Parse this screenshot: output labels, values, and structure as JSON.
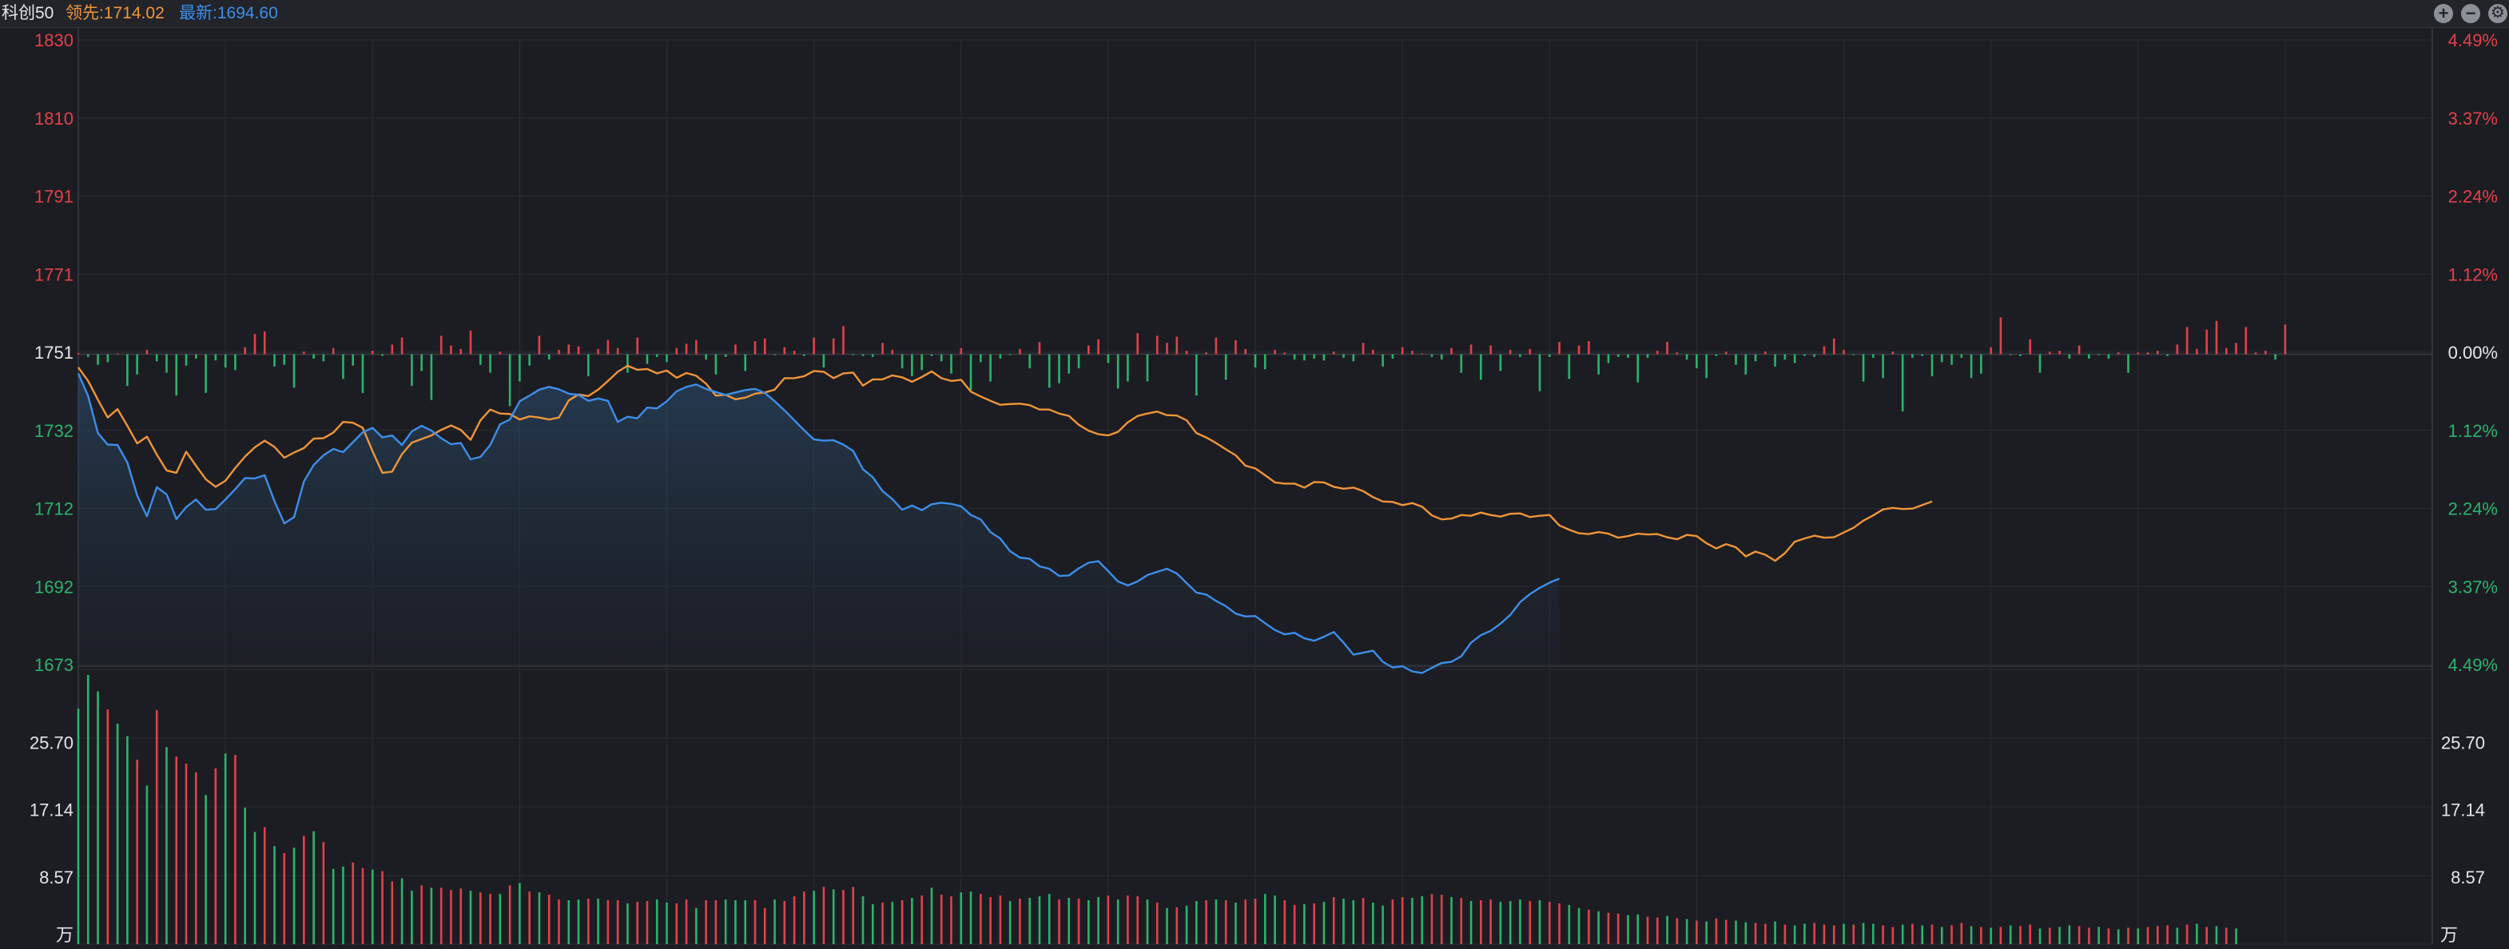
{
  "header": {
    "name": "科创50",
    "leader_label": "领先:1714.02",
    "latest_label": "最新:1694.60"
  },
  "controls": [
    {
      "name": "zoom-in-icon",
      "glyph": "+"
    },
    {
      "name": "zoom-out-icon",
      "glyph": "−"
    },
    {
      "name": "settings-icon",
      "glyph": "⚙"
    }
  ],
  "colors": {
    "background": "#1c1d22",
    "up": "#e2414b",
    "down": "#2bb36e",
    "leader_line": "#f0953a",
    "latest_line": "#3d8eea",
    "grid": "#2a2c33",
    "neutral_text": "#e4e6ea"
  },
  "chart_data": {
    "type": "line",
    "price_panel": {
      "ylim": [
        1673,
        1830
      ],
      "base_price": 1751,
      "left_ticks": [
        "1830",
        "1810",
        "1791",
        "1771",
        "1751",
        "1732",
        "1712",
        "1692",
        "1673"
      ],
      "right_ticks": [
        "4.49%",
        "3.37%",
        "2.24%",
        "1.12%",
        "0.00%",
        "1.12%",
        "2.24%",
        "3.37%",
        "4.49%"
      ],
      "total_minutes": 241,
      "series": [
        {
          "key": "leader",
          "values": [
            1747.7,
            1744.3,
            1739.6,
            1735.1,
            1737.2,
            1733.0,
            1728.6,
            1730.3,
            1725.8,
            1721.8,
            1721.2,
            1726.5,
            1723.0,
            1719.6,
            1717.7,
            1719.2,
            1722.4,
            1725.3,
            1727.6,
            1729.3,
            1727.7,
            1725.0,
            1726.3,
            1727.4,
            1729.8,
            1729.9,
            1731.3,
            1734.0,
            1733.8,
            1732.5,
            1726.6,
            1721.2,
            1721.5,
            1725.9,
            1728.8,
            1729.7,
            1730.6,
            1732.0,
            1733.1,
            1732.0,
            1729.5,
            1734.4,
            1737.1,
            1736.1,
            1736.0,
            1734.6,
            1735.4,
            1735.1,
            1734.6,
            1735.1,
            1739.4,
            1740.9,
            1740.5,
            1742.1,
            1744.3,
            1746.6,
            1748.1,
            1747.1,
            1747.3,
            1746.2,
            1746.9,
            1745.1,
            1746.3,
            1745.6,
            1743.6,
            1740.6,
            1740.8,
            1739.7,
            1740.1,
            1741.1,
            1741.4,
            1742.1,
            1745.0,
            1745.0,
            1745.5,
            1746.8,
            1746.6,
            1745.0,
            1746.2,
            1746.4,
            1743.1,
            1744.7,
            1744.7,
            1745.7,
            1745.2,
            1744.1,
            1745.3,
            1746.7,
            1745.0,
            1744.3,
            1744.6,
            1741.6,
            1740.4,
            1739.3,
            1738.3,
            1738.5,
            1738.6,
            1738.2,
            1737.1,
            1737.1,
            1736.1,
            1735.5,
            1733.3,
            1731.8,
            1730.9,
            1730.6,
            1731.5,
            1733.9,
            1735.5,
            1736.1,
            1736.6,
            1735.7,
            1735.6,
            1734.4,
            1731.2,
            1730.1,
            1728.7,
            1727.1,
            1725.6,
            1723.0,
            1722.3,
            1720.6,
            1718.8,
            1718.5,
            1718.5,
            1717.5,
            1718.9,
            1718.8,
            1717.7,
            1717.2,
            1717.5,
            1716.6,
            1715.1,
            1714.0,
            1713.9,
            1713.1,
            1713.6,
            1712.7,
            1710.5,
            1709.5,
            1709.7,
            1710.6,
            1710.4,
            1711.2,
            1710.6,
            1710.2,
            1710.9,
            1711.0,
            1710.1,
            1710.4,
            1710.6,
            1708.0,
            1706.9,
            1706.0,
            1705.8,
            1706.3,
            1705.9,
            1704.9,
            1705.3,
            1705.9,
            1705.7,
            1705.8,
            1705.0,
            1704.5,
            1705.6,
            1705.3,
            1703.5,
            1702.2,
            1703.3,
            1702.5,
            1700.2,
            1701.4,
            1700.6,
            1699.1,
            1701.0,
            1703.9,
            1704.7,
            1705.4,
            1704.9,
            1705.0,
            1706.2,
            1707.4,
            1709.2,
            1710.5,
            1712.0,
            1712.4,
            1712.1,
            1712.2,
            1713.1,
            1714.0
          ],
          "color": "#f0953a"
        },
        {
          "key": "latest",
          "values": [
            1746.2,
            1740.5,
            1731.2,
            1728.3,
            1728.2,
            1723.8,
            1715.5,
            1710.3,
            1717.6,
            1715.8,
            1709.6,
            1712.6,
            1714.5,
            1711.9,
            1712.1,
            1714.5,
            1717.1,
            1719.9,
            1719.8,
            1720.6,
            1714.1,
            1708.5,
            1710.1,
            1719.0,
            1723.2,
            1725.6,
            1727.2,
            1726.4,
            1728.9,
            1731.4,
            1732.5,
            1730.1,
            1730.6,
            1728.2,
            1731.6,
            1733.0,
            1731.8,
            1729.9,
            1728.4,
            1728.7,
            1724.6,
            1725.2,
            1728.2,
            1733.4,
            1734.6,
            1739.2,
            1740.6,
            1742.1,
            1742.8,
            1742.2,
            1741.1,
            1740.8,
            1739.3,
            1739.9,
            1739.3,
            1734.0,
            1735.3,
            1734.9,
            1737.6,
            1737.4,
            1739.2,
            1741.7,
            1742.8,
            1743.4,
            1742.3,
            1741.5,
            1740.8,
            1741.4,
            1742.0,
            1742.3,
            1741.3,
            1739.2,
            1736.9,
            1734.4,
            1731.9,
            1729.6,
            1729.3,
            1729.4,
            1728.3,
            1726.7,
            1722.1,
            1720.1,
            1716.6,
            1714.6,
            1711.9,
            1713.0,
            1711.8,
            1713.3,
            1713.7,
            1713.4,
            1712.8,
            1710.6,
            1709.5,
            1706.3,
            1704.7,
            1701.5,
            1699.9,
            1699.6,
            1697.7,
            1697.1,
            1695.3,
            1695.4,
            1697.2,
            1698.6,
            1699.0,
            1696.5,
            1693.9,
            1692.9,
            1693.9,
            1695.5,
            1696.3,
            1697.1,
            1695.9,
            1693.5,
            1691.1,
            1690.6,
            1689.0,
            1687.7,
            1685.8,
            1685.1,
            1685.2,
            1683.4,
            1681.7,
            1680.6,
            1681.0,
            1679.6,
            1679.0,
            1680.0,
            1681.2,
            1678.5,
            1675.5,
            1676.0,
            1676.5,
            1673.7,
            1672.3,
            1672.6,
            1671.3,
            1670.9,
            1672.2,
            1673.4,
            1673.7,
            1675.1,
            1678.5,
            1680.4,
            1681.5,
            1683.3,
            1685.5,
            1688.7,
            1690.7,
            1692.3,
            1693.6,
            1694.6
          ],
          "color": "#3d8eea"
        }
      ]
    },
    "strength_bars": {
      "values": [
        0.15,
        -0.3,
        -1.2,
        -0.9,
        0.1,
        -3.6,
        -2.3,
        0.5,
        -0.8,
        -2.1,
        -4.7,
        -1.3,
        -0.5,
        -4.4,
        -0.7,
        -1.5,
        -1.8,
        0.8,
        2.3,
        2.6,
        -1.4,
        -1.2,
        -3.8,
        0.3,
        -0.5,
        -0.8,
        0.7,
        -2.8,
        -1.3,
        -4.4,
        0.4,
        -0.2,
        1.1,
        1.9,
        -3.6,
        -1.9,
        -5.2,
        2.1,
        1.0,
        0.6,
        2.7,
        -1.2,
        -2.1,
        0.3,
        -5.9,
        -3.1,
        -1.3,
        2.1,
        -0.6,
        0.5,
        1.1,
        0.9,
        -2.5,
        0.6,
        1.6,
        0.7,
        -2.1,
        1.9,
        -1.1,
        -0.3,
        -0.9,
        0.7,
        1.2,
        1.6,
        -0.6,
        -2.3,
        -0.3,
        1.1,
        -1.9,
        1.5,
        1.8,
        -0.1,
        0.8,
        0.4,
        -0.2,
        1.9,
        -1.5,
        1.8,
        3.2,
        -0.1,
        -0.2,
        -0.3,
        1.3,
        0.5,
        -1.6,
        -2.5,
        -1.8,
        -0.2,
        -0.8,
        -2.2,
        0.7,
        -4.1,
        -0.9,
        -3.1,
        -0.5,
        -0.1,
        0.6,
        -1.6,
        1.4,
        -3.8,
        -3.3,
        -2.2,
        -1.6,
        1.0,
        1.7,
        -1.0,
        -3.9,
        -3.1,
        2.4,
        -3.1,
        2.1,
        1.3,
        2.0,
        0.4,
        -4.7,
        0.2,
        1.9,
        -2.9,
        1.6,
        0.6,
        -1.5,
        -1.7,
        0.5,
        0.2,
        -0.6,
        -0.7,
        -0.5,
        -0.7,
        0.3,
        -0.4,
        -0.8,
        1.3,
        0.5,
        -1.4,
        -0.5,
        0.8,
        0.4,
        0.1,
        -0.3,
        -0.6,
        0.7,
        -2.1,
        1.1,
        -2.9,
        1.0,
        -1.9,
        0.5,
        -0.3,
        0.6,
        -4.2,
        -0.3,
        1.4,
        -2.8,
        1.0,
        1.5,
        -2.3,
        -1.0,
        -0.3,
        -0.4,
        -3.2,
        -0.4,
        0.4,
        1.4,
        0.2,
        -0.6,
        -1.6,
        -2.7,
        -0.2,
        0.3,
        -1.2,
        -2.3,
        -0.8,
        0.3,
        -1.4,
        -0.6,
        -1.0,
        -0.2,
        -0.3,
        0.9,
        1.8,
        0.5,
        -0.1,
        -3.1,
        -0.4,
        -2.7,
        0.3,
        -6.5,
        -0.4,
        -0.2,
        -2.5,
        -0.9,
        -1.2,
        -0.4,
        -2.7,
        -2.2,
        0.8,
        4.2,
        -0.1,
        -0.2,
        1.7,
        -2.1,
        0.3,
        0.4,
        -0.5,
        1.0,
        -0.5,
        -0.1,
        -0.5,
        0.2,
        -2.1,
        0.2,
        0.2,
        0.4,
        -0.2,
        1.1,
        3.1,
        0.6,
        2.8,
        3.8,
        0.7,
        1.3,
        3.1,
        0.2,
        0.4,
        -0.6,
        3.4
      ]
    },
    "volume_panel": {
      "ylim": [
        0,
        35
      ],
      "unit": "万",
      "left_ticks": [
        "25.70",
        "17.14",
        "8.57"
      ],
      "right_ticks": [
        "25.70",
        "17.14",
        "8.57"
      ],
      "values": [
        30,
        34.3,
        32.2,
        29.9,
        28.1,
        26.5,
        23.5,
        20.2,
        29.8,
        25.1,
        23.9,
        23.0,
        21.9,
        19.0,
        22.4,
        24.3,
        24.1,
        17.4,
        14.3,
        14.9,
        12.5,
        11.6,
        12.3,
        13.8,
        14.4,
        13.0,
        9.6,
        9.9,
        10.4,
        9.7,
        9.5,
        9.3,
        8.0,
        8.4,
        6.8,
        7.5,
        7.2,
        7.2,
        6.9,
        7.1,
        6.8,
        6.6,
        6.4,
        6.4,
        7.5,
        7.8,
        6.7,
        6.6,
        6.3,
        5.7,
        5.6,
        5.7,
        5.8,
        5.8,
        5.6,
        5.6,
        5.2,
        5.4,
        5.5,
        5.7,
        5.3,
        5.2,
        5.7,
        4.6,
        5.6,
        5.6,
        5.7,
        5.6,
        5.6,
        5.6,
        4.6,
        5.7,
        5.5,
        6.1,
        6.7,
        6.8,
        7.3,
        7.0,
        6.9,
        7.3,
        6.1,
        5.1,
        5.3,
        5.4,
        5.6,
        5.9,
        6.2,
        7.2,
        6.3,
        6.1,
        6.6,
        6.7,
        6.4,
        6.0,
        6.2,
        5.5,
        5.8,
        5.9,
        6.1,
        6.4,
        5.7,
        5.9,
        5.8,
        5.6,
        6.0,
        6.2,
        5.7,
        6.2,
        6.1,
        5.7,
        5.3,
        4.6,
        4.7,
        4.9,
        5.5,
        5.6,
        5.7,
        5.6,
        5.3,
        5.7,
        5.8,
        6.4,
        6.2,
        5.6,
        5.0,
        5.1,
        5.2,
        5.4,
        6.0,
        5.8,
        5.6,
        5.9,
        5.3,
        4.9,
        5.7,
        6.0,
        5.9,
        6.1,
        6.4,
        6.3,
        6.0,
        5.9,
        5.5,
        5.6,
        5.7,
        5.4,
        5.5,
        5.7,
        5.5,
        5.6,
        5.4,
        5.2,
        5.0,
        4.6,
        4.4,
        4.2,
        4.0,
        3.9,
        3.7,
        3.8,
        3.5,
        3.4,
        3.6,
        3.3,
        3.2,
        3.0,
        2.9,
        3.3,
        3.1,
        3.0,
        2.8,
        2.7,
        2.6,
        2.9,
        2.5,
        2.4,
        2.6,
        2.7,
        2.5,
        2.4,
        2.6,
        2.5,
        2.7,
        2.6,
        2.4,
        2.2,
        2.5,
        2.6,
        2.4,
        2.5,
        2.2,
        2.4,
        2.7,
        2.3,
        2.2,
        2.1,
        2.2,
        2.4,
        2.3,
        2.5,
        2.0,
        2.1,
        2.2,
        2.4,
        2.3,
        2.1,
        2.2,
        2.0,
        1.9,
        2.1,
        2.0,
        2.2,
        2.3,
        2.4,
        2.1,
        2.5,
        2.6,
        2.2,
        2.3,
        2.1,
        2.0
      ],
      "colors": [
        "down",
        "down",
        "down",
        "up",
        "down",
        "down",
        "up",
        "down",
        "up",
        "down",
        "up",
        "up",
        "up",
        "down",
        "up",
        "down",
        "up",
        "down",
        "down",
        "up",
        "down",
        "up",
        "down",
        "up",
        "down",
        "up",
        "down",
        "down",
        "up",
        "up",
        "down",
        "up",
        "up",
        "down",
        "down",
        "up",
        "down",
        "up",
        "up",
        "up",
        "down",
        "up",
        "up",
        "down",
        "up",
        "down",
        "up",
        "down",
        "up",
        "up",
        "down",
        "down",
        "up",
        "down",
        "up",
        "up",
        "down",
        "up",
        "up",
        "down",
        "down",
        "up",
        "up",
        "down",
        "up",
        "up",
        "down",
        "down",
        "down",
        "up",
        "up",
        "down",
        "up",
        "up",
        "up",
        "down",
        "up",
        "down",
        "up",
        "up",
        "down",
        "down",
        "up",
        "down",
        "up",
        "down",
        "up",
        "down",
        "up",
        "up",
        "down",
        "down",
        "up",
        "up",
        "up",
        "down",
        "up",
        "down",
        "down",
        "down",
        "up",
        "down",
        "up",
        "down",
        "down",
        "up",
        "down",
        "up",
        "up",
        "down",
        "up",
        "down",
        "up",
        "down",
        "down",
        "up",
        "down",
        "up",
        "down",
        "up",
        "up",
        "down",
        "down",
        "up",
        "up",
        "down",
        "up",
        "down",
        "up",
        "down",
        "down",
        "up",
        "down",
        "down",
        "up",
        "up",
        "down",
        "down",
        "up",
        "up",
        "down",
        "up",
        "down",
        "up",
        "up",
        "down",
        "down",
        "down",
        "up",
        "down",
        "up",
        "up",
        "down",
        "down",
        "up",
        "down",
        "up",
        "up",
        "down",
        "down",
        "up",
        "up",
        "down",
        "up",
        "down",
        "up",
        "down",
        "up",
        "up",
        "down",
        "down",
        "up",
        "up",
        "down",
        "up",
        "down",
        "down",
        "up",
        "up",
        "up",
        "down",
        "up",
        "down",
        "down",
        "up",
        "up",
        "down",
        "up",
        "down",
        "up",
        "down",
        "up",
        "up",
        "down",
        "up",
        "down",
        "up",
        "down",
        "up",
        "up",
        "down",
        "up",
        "down",
        "down",
        "up",
        "up",
        "down",
        "up",
        "down",
        "up",
        "down",
        "up",
        "up",
        "up",
        "down",
        "up",
        "down",
        "up",
        "down",
        "up"
      ]
    }
  }
}
